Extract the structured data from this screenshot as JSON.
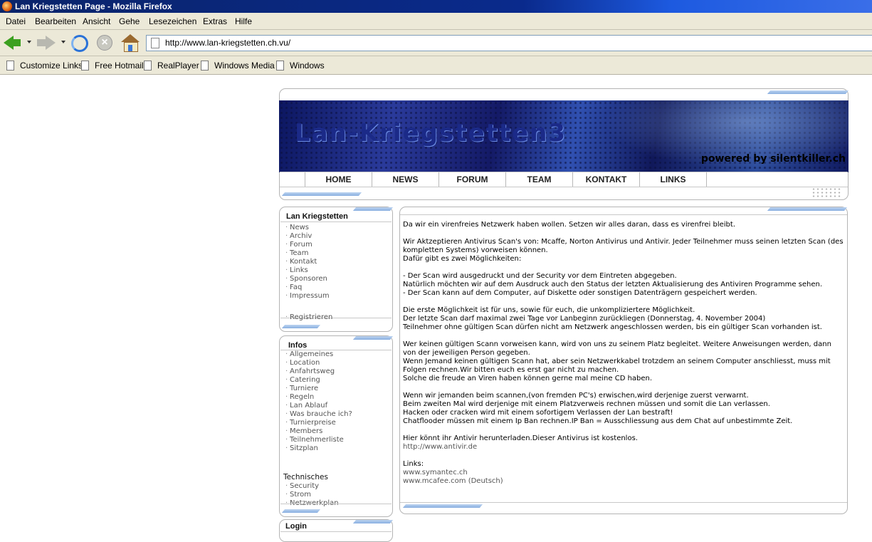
{
  "window": {
    "title": "Lan Kriegstetten Page - Mozilla Firefox"
  },
  "menu": [
    "Datei",
    "Bearbeiten",
    "Ansicht",
    "Gehe",
    "Lesezeichen",
    "Extras",
    "Hilfe"
  ],
  "url": "http://www.lan-kriegstetten.ch.vu/",
  "bookmarks": [
    "Customize Links",
    "Free Hotmail",
    "RealPlayer",
    "Windows Media",
    "Windows"
  ],
  "banner": {
    "title": "Lan-Kriegstetten3",
    "powered": "powered by silentkiller.ch"
  },
  "nav": [
    "HOME",
    "NEWS",
    "FORUM",
    "TEAM",
    "KONTAKT",
    "LINKS"
  ],
  "sidebar1": {
    "title": "Lan Kriegstetten",
    "items": [
      "News",
      "Archiv",
      "Forum",
      "Team",
      "Kontakt",
      "Links",
      "Sponsoren",
      "Faq",
      "Impressum"
    ],
    "extra": "Registrieren"
  },
  "sidebar2": {
    "title": "Infos",
    "items": [
      "Allgemeines",
      "Location",
      "Anfahrtsweg",
      "Catering",
      "Turniere",
      "Regeln",
      "Lan Ablauf",
      "Was brauche ich?",
      "Turnierpreise",
      "Members",
      "Teilnehmerliste",
      "Sitzplan"
    ],
    "section": "Technisches",
    "tech": [
      "Security",
      "Strom",
      "Netzwerkplan"
    ]
  },
  "sidebar3": {
    "title": "Login"
  },
  "main": {
    "p1": "Da wir ein virenfreies Netzwerk haben wollen. Setzen wir alles daran, dass es virenfrei bleibt.",
    "p2": [
      "Wir Aktzeptieren Antivirus Scan's von: Mcaffe, Norton Antivirus und Antivir. Jeder Teilnehmer muss seinen letzten Scan (des kompletten Systems) vorweisen können.",
      "Dafür gibt es zwei Möglichkeiten:"
    ],
    "p3": [
      "- Der Scan wird ausgedruckt und der Security vor dem Eintreten abgegeben.",
      "Natürlich möchten wir auf dem Ausdruck auch den Status der letzten Aktualisierung des Antiviren Programme sehen.",
      "- Der Scan kann auf dem Computer, auf Diskette oder sonstigen Datenträgern gespeichert werden."
    ],
    "p4": [
      "Die erste Möglichkeit ist für uns, sowie für euch, die unkompliziertere Möglichkeit.",
      "Der letzte Scan darf maximal zwei Tage vor Lanbeginn zurückliegen (Donnerstag, 4. November 2004)",
      "Teilnehmer ohne gültigen Scan dürfen nicht am Netzwerk angeschlossen werden, bis ein gültiger Scan vorhanden ist."
    ],
    "p5": [
      "Wer keinen gültigen Scann vorweisen kann, wird von uns zu seinem Platz begleitet. Weitere Anweisungen werden, dann von der jeweiligen Person gegeben.",
      "Wenn Jemand keinen gültigen Scann hat, aber sein Netzwerkkabel trotzdem an seinem Computer anschliesst, muss mit Folgen rechnen.Wir bitten euch es erst gar nicht zu machen.",
      "Solche die freude an Viren haben können gerne mal meine CD haben."
    ],
    "p6": [
      "Wenn wir jemanden beim scannen,(von fremden PC's) erwischen,wird derjenige zuerst verwarnt.",
      "Beim zweiten Mal wird derjenige mit einem Platzverweis rechnen müssen und somit die Lan verlassen.",
      "Hacken oder cracken wird mit einem sofortigem Verlassen der Lan bestraft!",
      "Chatflooder müssen mit einem Ip Ban rechnen.IP Ban = Ausschliessung aus dem Chat auf unbestimmte Zeit."
    ],
    "p7": "Hier könnt ihr Antivir herunterladen.Dieser Antivirus ist kostenlos.",
    "antivir_link": "http://www.antivir.de",
    "links_label": "Links:",
    "link1": "www.symantec.ch",
    "link2": "www.mcafee.com (Deutsch)"
  }
}
